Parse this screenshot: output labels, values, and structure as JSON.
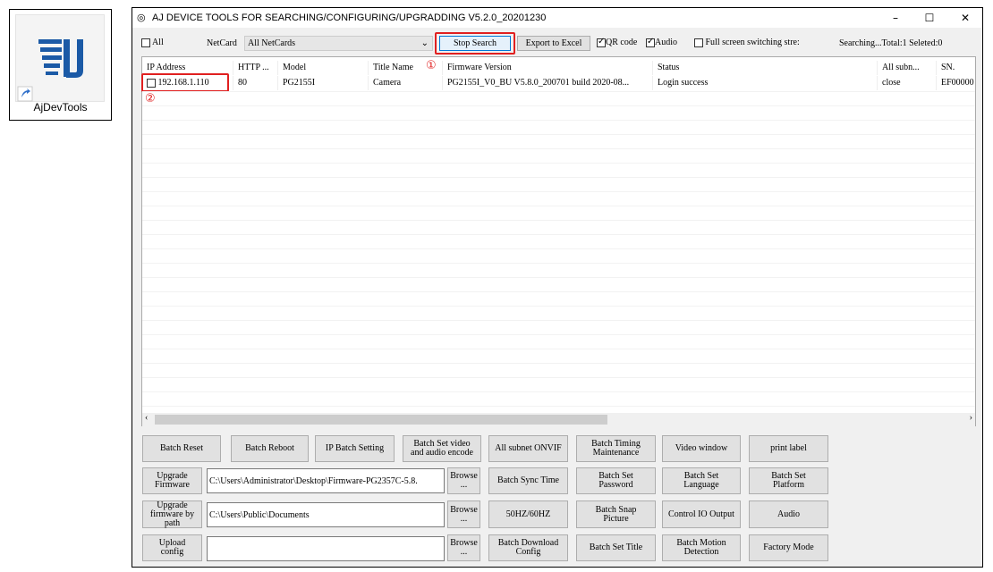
{
  "desktop": {
    "icon_label": "AjDevTools"
  },
  "window": {
    "title": "AJ DEVICE TOOLS FOR SEARCHING/CONFIGURING/UPGRADDING V5.2.0_20201230"
  },
  "toolbar": {
    "all_label": "All",
    "netcard_label": "NetCard",
    "netcard_value": "All NetCards",
    "stop_search": "Stop Search",
    "export": "Export to Excel",
    "qr_code": "QR code",
    "audio": "Audio",
    "fullscreen": "Full screen switching stre:",
    "status": "Searching...Total:1 Seleted:0"
  },
  "annotations": {
    "one": "①",
    "two": "②"
  },
  "table": {
    "columns": [
      "IP Address",
      "HTTP ...",
      "Model",
      "Title Name",
      "Firmware Version",
      "Status",
      "All subn...",
      "SN."
    ],
    "rows": [
      [
        "192.168.1.110",
        "80",
        "PG2155I",
        "Camera",
        "PG2155I_V0_BU V5.8.0_200701 build 2020-08...",
        "Login success",
        "close",
        "EF00000"
      ]
    ]
  },
  "buttons": {
    "batch_reset": "Batch Reset",
    "batch_reboot": "Batch Reboot",
    "ip_batch": "IP Batch Setting",
    "video_encode": "Batch Set video\nand audio encode",
    "onvif": "All subnet ONVIF",
    "timing": "Batch Timing\nMaintenance",
    "video_window": "Video window",
    "print_label": "print label",
    "upgrade_fw": "Upgrade\nFirmware",
    "browse": "Browse\n...",
    "sync_time": "Batch Sync Time",
    "set_password": "Batch Set\nPassword",
    "set_language": "Batch Set\nLanguage",
    "set_platform": "Batch Set\nPlatform",
    "upgrade_path": "Upgrade\nfirmware by\npath",
    "hz": "50HZ/60HZ",
    "snap": "Batch Snap\nPicture",
    "io_output": "Control IO Output",
    "audio": "Audio",
    "upload_config": "Upload\nconfig",
    "download_config": "Batch Download\nConfig",
    "set_title": "Batch Set Title",
    "motion": "Batch Motion\nDetection",
    "factory": "Factory Mode"
  },
  "inputs": {
    "firmware_path": "C:\\Users\\Administrator\\Desktop\\Firmware-PG2357C-5.8.",
    "path": "C:\\Users\\Public\\Documents",
    "config": ""
  }
}
